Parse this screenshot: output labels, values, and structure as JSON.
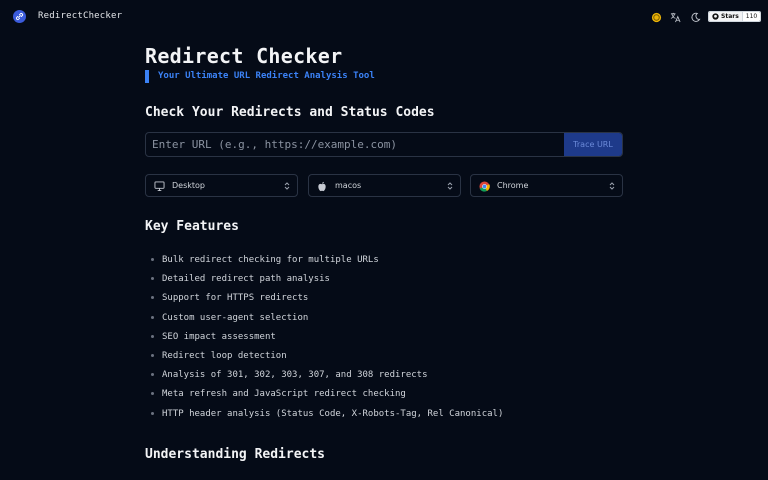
{
  "nav": {
    "brand": "RedirectChecker",
    "github": {
      "stars_label": "Stars",
      "count": "110"
    }
  },
  "header": {
    "title": "Redirect Checker",
    "tagline": "Your Ultimate URL Redirect Analysis Tool"
  },
  "check": {
    "heading": "Check Your Redirects and Status Codes",
    "url_placeholder": "Enter URL (e.g., https://example.com)",
    "url_value": "",
    "trace_button": "Trace URL",
    "device": {
      "value": "Desktop",
      "icon": "monitor-icon"
    },
    "os": {
      "value": "macos",
      "icon": "apple-icon"
    },
    "browser": {
      "value": "Chrome",
      "icon": "chrome-icon"
    }
  },
  "features": {
    "heading": "Key Features",
    "items": [
      "Bulk redirect checking for multiple URLs",
      "Detailed redirect path analysis",
      "Support for HTTPS redirects",
      "Custom user-agent selection",
      "SEO impact assessment",
      "Redirect loop detection",
      "Analysis of 301, 302, 303, 307, and 308 redirects",
      "Meta refresh and JavaScript redirect checking",
      "HTTP header analysis (Status Code, X-Robots-Tag, Rel Canonical)"
    ]
  },
  "understanding": {
    "heading": "Understanding Redirects"
  },
  "colors": {
    "background": "#050b17",
    "accent": "#3b82f6",
    "button": "#1e3a8a"
  }
}
